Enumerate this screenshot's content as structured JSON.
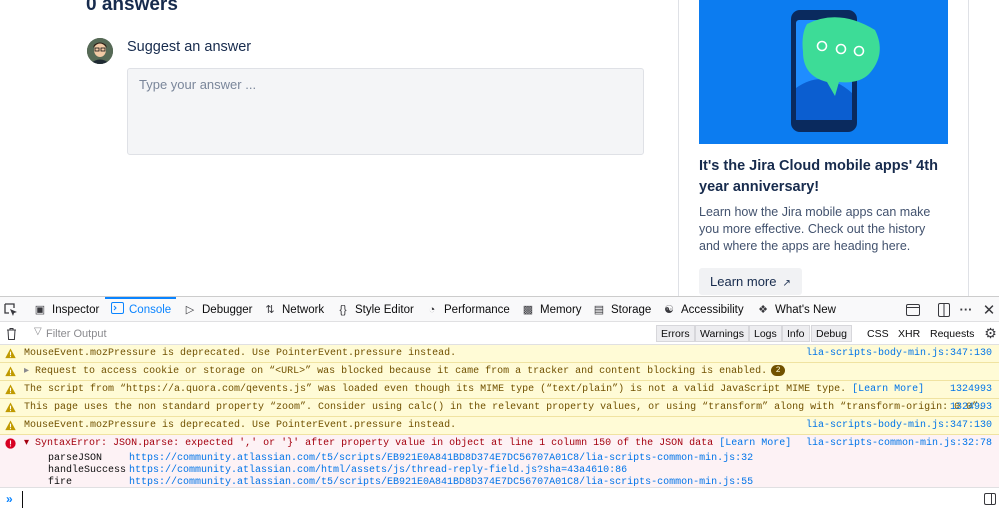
{
  "page": {
    "answers_title": "0 answers",
    "suggest_label": "Suggest an answer",
    "answer_placeholder": "Type your answer ...",
    "card": {
      "title": "It's the Jira Cloud mobile apps' 4th year anniversary!",
      "description": "Learn how the Jira mobile apps can make you more effective. Check out the history and where the apps are heading here.",
      "button_label": "Learn more",
      "hero_color": "#0c7cf0"
    }
  },
  "devtools": {
    "tabs": [
      {
        "label": "Inspector",
        "icon": "inspector-icon"
      },
      {
        "label": "Console",
        "icon": "console-icon",
        "active": true
      },
      {
        "label": "Debugger",
        "icon": "debugger-icon"
      },
      {
        "label": "Network",
        "icon": "network-icon"
      },
      {
        "label": "Style Editor",
        "icon": "style-editor-icon"
      },
      {
        "label": "Performance",
        "icon": "performance-icon"
      },
      {
        "label": "Memory",
        "icon": "memory-icon"
      },
      {
        "label": "Storage",
        "icon": "storage-icon"
      },
      {
        "label": "Accessibility",
        "icon": "accessibility-icon"
      },
      {
        "label": "What's New",
        "icon": "gift-icon"
      }
    ],
    "filter_placeholder": "Filter Output",
    "filter_buttons": [
      "Errors",
      "Warnings",
      "Logs",
      "Info",
      "Debug"
    ],
    "request_filters": [
      "CSS",
      "XHR",
      "Requests"
    ],
    "messages": [
      {
        "level": "warning",
        "text": "MouseEvent.mozPressure is deprecated. Use PointerEvent.pressure instead.",
        "source": "lia-scripts-body-min.js:347:130"
      },
      {
        "level": "warning",
        "expandable": true,
        "text": "Request to access cookie or storage on “<URL>” was blocked because it came from a tracker and content blocking is enabled.",
        "count": "2",
        "source": ""
      },
      {
        "level": "warning",
        "text": "The script from “https://a.quora.com/qevents.js” was loaded even though its MIME type (“text/plain”) is not a valid JavaScript MIME type.",
        "link": "[Learn More]",
        "source": "1324993"
      },
      {
        "level": "warning",
        "text": "This page uses the non standard property “zoom”. Consider using calc() in the relevant property values, or using “transform” along with “transform-origin: 0 0”.",
        "source": "1324993"
      },
      {
        "level": "warning",
        "text": "MouseEvent.mozPressure is deprecated. Use PointerEvent.pressure instead.",
        "source": "lia-scripts-body-min.js:347:130"
      }
    ],
    "error": {
      "text": "SyntaxError: JSON.parse: expected ',' or '}' after property value in object at line 1 column 150 of the JSON data",
      "link": "[Learn More]",
      "source": "lia-scripts-common-min.js:32:78",
      "stack": [
        {
          "fn": "parseJSON",
          "url": "https://community.atlassian.com/t5/scripts/EB921E0A841BD8D374E7DC56707A01C8/lia-scripts-common-min.js:32"
        },
        {
          "fn": "handleSuccess",
          "url": "https://community.atlassian.com/html/assets/js/thread-reply-field.js?sha=43a4610:86"
        },
        {
          "fn": "fire",
          "url": "https://community.atlassian.com/t5/scripts/EB921E0A841BD8D374E7DC56707A01C8/lia-scripts-common-min.js:55"
        }
      ]
    },
    "prompt_symbol": "»"
  }
}
